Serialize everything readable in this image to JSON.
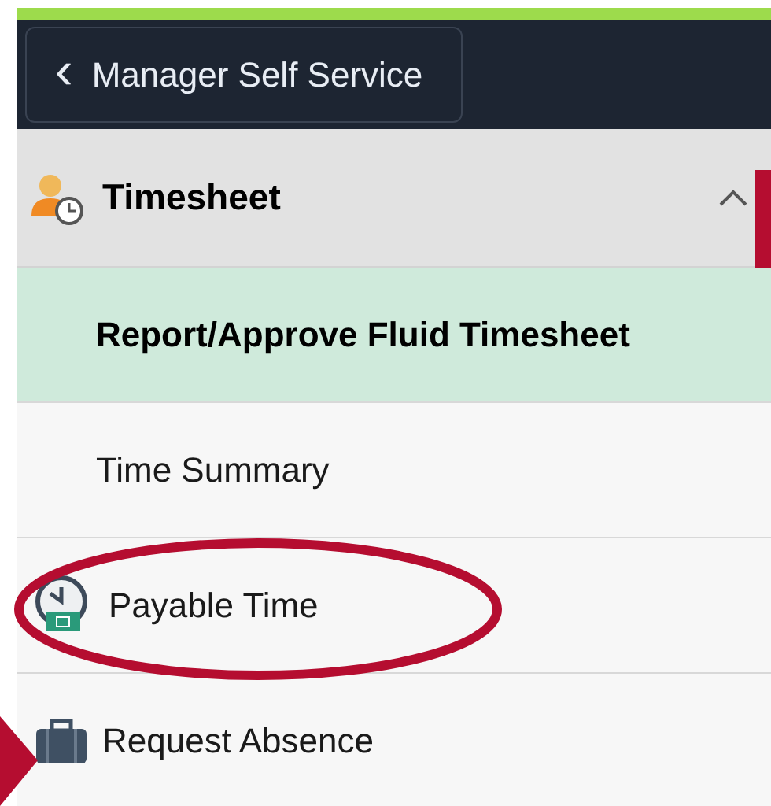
{
  "header": {
    "back_button": {
      "icon": "‹",
      "label": "Manager Self Service"
    }
  },
  "group": {
    "label": "Timesheet",
    "expanded": true
  },
  "items": [
    {
      "label": "Report/Approve Fluid Timesheet",
      "selected": true,
      "kind": "plain"
    },
    {
      "label": "Time Summary",
      "selected": false,
      "kind": "plain"
    },
    {
      "label": "Payable Time",
      "selected": false,
      "kind": "clock"
    },
    {
      "label": "Request Absence",
      "selected": false,
      "kind": "briefcase"
    }
  ]
}
